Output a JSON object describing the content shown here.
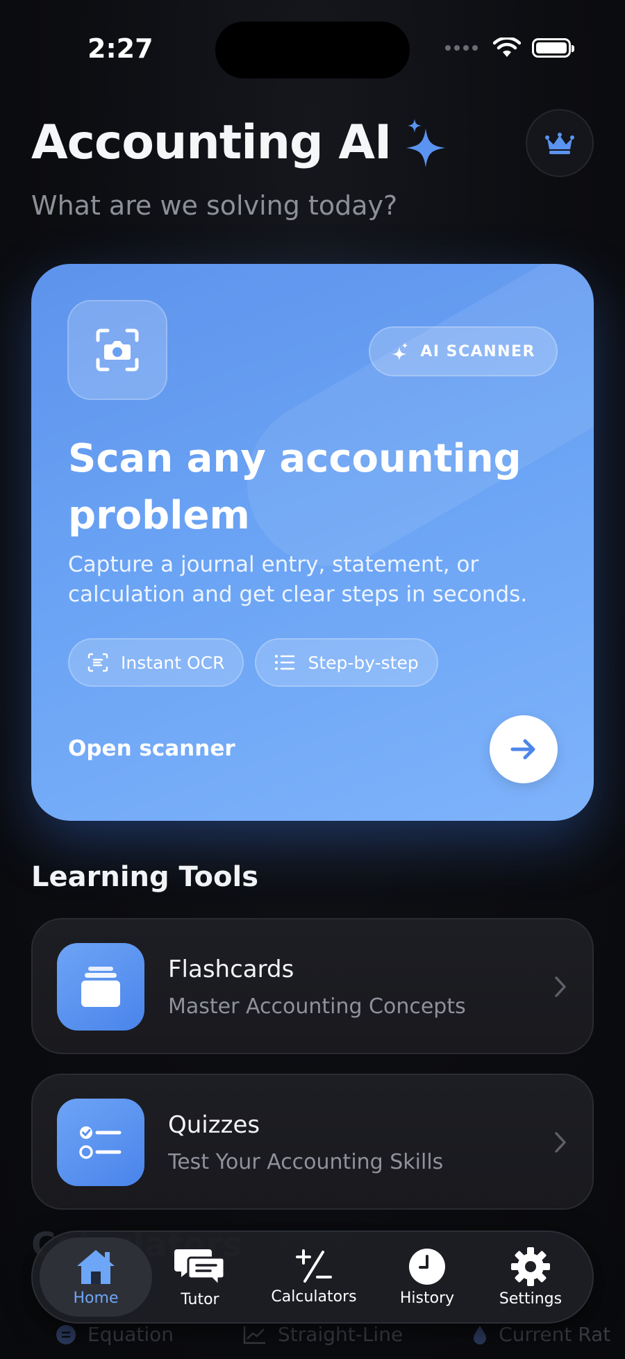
{
  "status": {
    "time": "2:27"
  },
  "header": {
    "title": "Accounting AI",
    "subtitle": "What are we solving today?"
  },
  "scanner": {
    "badge": "AI SCANNER",
    "heading": "Scan any accounting problem",
    "description": "Capture a journal entry, statement, or calculation and get clear steps in seconds.",
    "chips": [
      "Instant OCR",
      "Step-by-step"
    ],
    "action_label": "Open scanner"
  },
  "learning_tools": {
    "title": "Learning Tools",
    "items": [
      {
        "name": "Flashcards",
        "description": "Master Accounting Concepts",
        "icon": "cards-icon"
      },
      {
        "name": "Quizzes",
        "description": "Test Your Accounting Skills",
        "icon": "checklist-icon"
      }
    ]
  },
  "peek": {
    "title": "Calculators",
    "items": [
      "Equation",
      "Straight-Line",
      "Current Rat"
    ]
  },
  "tabbar": {
    "tabs": [
      {
        "label": "Home",
        "icon": "home-icon",
        "active": true
      },
      {
        "label": "Tutor",
        "icon": "chat-icon",
        "active": false
      },
      {
        "label": "Calculators",
        "icon": "plus-minus-icon",
        "active": false
      },
      {
        "label": "History",
        "icon": "clock-icon",
        "active": false
      },
      {
        "label": "Settings",
        "icon": "gear-icon",
        "active": false
      }
    ]
  },
  "colors": {
    "accent": "#5e93ec",
    "background": "#0b0c10",
    "active_tab": "#6ea6f7"
  }
}
